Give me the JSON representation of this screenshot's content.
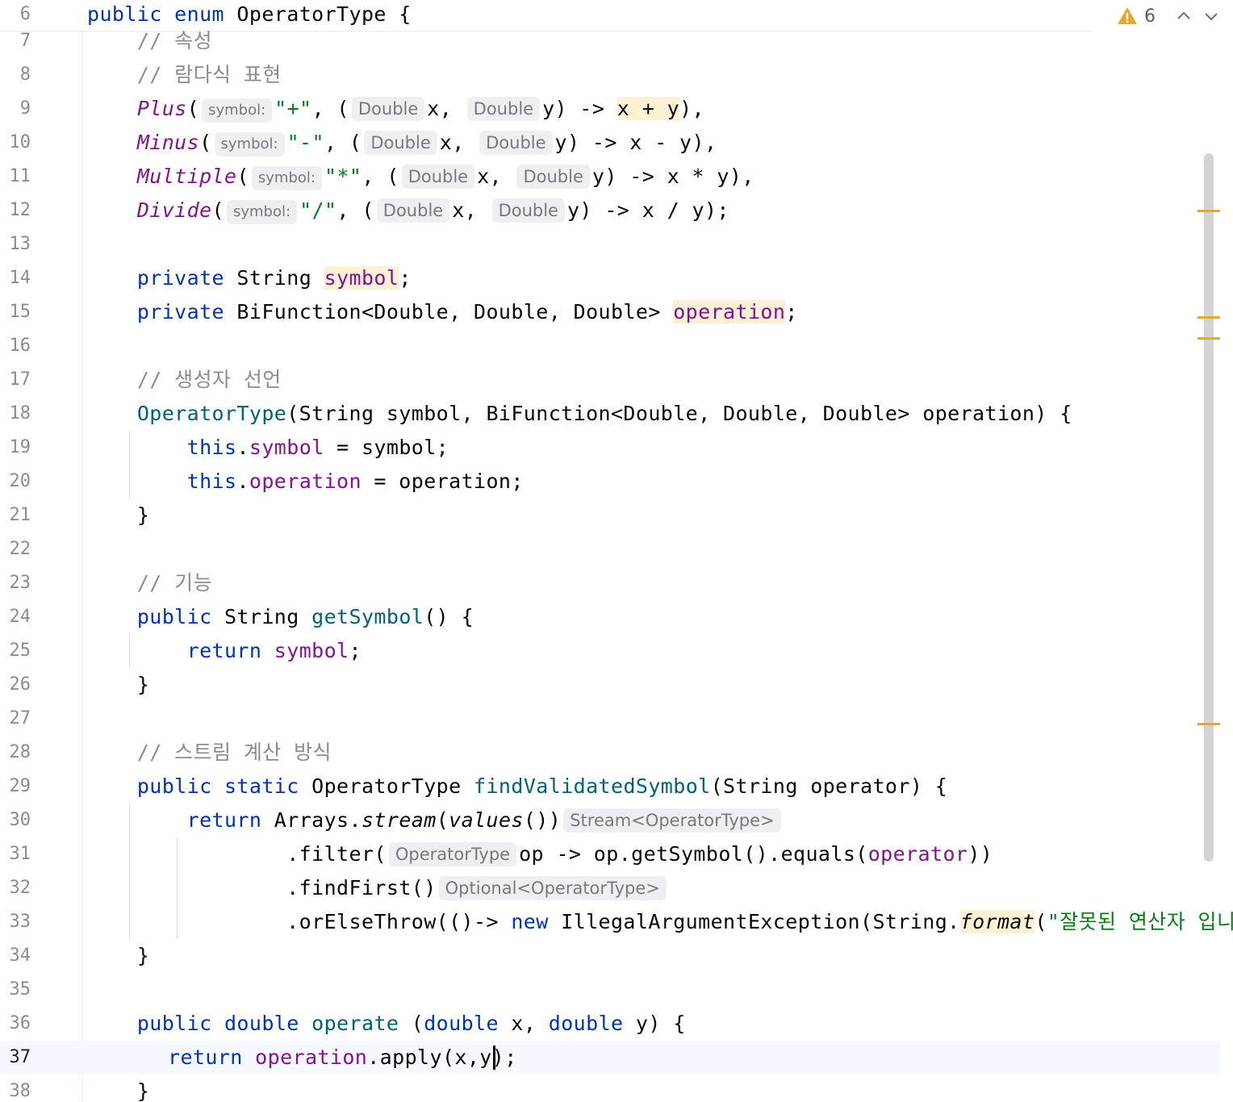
{
  "inspection": {
    "warning_count": "6",
    "warning_color": "#e5a82a"
  },
  "colors": {
    "keyword": "#0033b3",
    "field": "#871094",
    "string": "#067d17",
    "comment": "#8c8c8c",
    "method_decl": "#00627a",
    "highlight": "#fcf1d4",
    "hint_bg": "#eeeff2"
  },
  "lines": {
    "n6": "6",
    "n7": "7",
    "n8": "8",
    "n9": "9",
    "n10": "10",
    "n11": "11",
    "n12": "12",
    "n13": "13",
    "n14": "14",
    "n15": "15",
    "n16": "16",
    "n17": "17",
    "n18": "18",
    "n19": "19",
    "n20": "20",
    "n21": "21",
    "n22": "22",
    "n23": "23",
    "n24": "24",
    "n25": "25",
    "n26": "26",
    "n27": "27",
    "n28": "28",
    "n29": "29",
    "n30": "30",
    "n31": "31",
    "n32": "32",
    "n33": "33",
    "n34": "34",
    "n35": "35",
    "n36": "36",
    "n37": "37",
    "n38": "38"
  },
  "code": {
    "l6": {
      "kw1": "public",
      "kw2": "enum",
      "rest": " OperatorType {"
    },
    "l7": {
      "comment": "// 속성"
    },
    "l8": {
      "comment": "// 람다식 표현"
    },
    "l9": {
      "name": "Plus",
      "open": "(",
      "hint_symbol": "symbol:",
      "str": "\"+\"",
      "sep": ", (",
      "hint_x": "Double",
      "px": "x, ",
      "hint_y": "Double",
      "py": "y) -> ",
      "expr": "x + y",
      "close": "),"
    },
    "l10": {
      "name": "Minus",
      "open": "(",
      "hint_symbol": "symbol:",
      "str": "\"-\"",
      "sep": ", (",
      "hint_x": "Double",
      "px": "x, ",
      "hint_y": "Double",
      "py": "y) -> x - y),"
    },
    "l11": {
      "name": "Multiple",
      "open": "(",
      "hint_symbol": "symbol:",
      "str": "\"*\"",
      "sep": ", (",
      "hint_x": "Double",
      "px": "x, ",
      "hint_y": "Double",
      "py": "y) -> x * y),"
    },
    "l12": {
      "name": "Divide",
      "open": "(",
      "hint_symbol": "symbol:",
      "str": "\"/\"",
      "sep": ", (",
      "hint_x": "Double",
      "px": "x, ",
      "hint_y": "Double",
      "py": "y) -> x / y);"
    },
    "l14": {
      "kw": "private",
      "type": " String ",
      "field": "symbol",
      "end": ";"
    },
    "l15": {
      "kw": "private",
      "type": " BiFunction<Double, Double, Double> ",
      "field": "operation",
      "end": ";"
    },
    "l17": {
      "comment": "// 생성자 선언"
    },
    "l18": {
      "name": "OperatorType",
      "rest": "(String symbol, BiFunction<Double, Double, Double> operation) {"
    },
    "l19": {
      "kw": "this",
      "dot": ".",
      "field": "symbol",
      "rest": " = symbol;"
    },
    "l20": {
      "kw": "this",
      "dot": ".",
      "field": "operation",
      "rest": " = operation;"
    },
    "l21": {
      "brace": "}"
    },
    "l23": {
      "comment": "// 기능"
    },
    "l24": {
      "kw": "public",
      "type": " String ",
      "name": "getSymbol",
      "rest": "() {"
    },
    "l25": {
      "kw": "return",
      "field": "symbol",
      "end": ";"
    },
    "l26": {
      "brace": "}"
    },
    "l28": {
      "comment": "// 스트림 계산 방식"
    },
    "l29": {
      "kw1": "public",
      "kw2": "static",
      "type": " OperatorType ",
      "name": "findValidatedSymbol",
      "rest": "(String operator) {"
    },
    "l30": {
      "kw": "return",
      "p1": " Arrays.",
      "m1": "stream",
      "p2": "(",
      "m2": "values",
      "p3": "())",
      "hint": "Stream<OperatorType>"
    },
    "l31": {
      "p1": ".filter(",
      "hint": "OperatorType",
      "p2": "op -> op.getSymbol().equals(",
      "field": "operator",
      "p3": "))"
    },
    "l32": {
      "p1": ".findFirst()",
      "hint": "Optional<OperatorType>"
    },
    "l33": {
      "p1": ".orElseThrow(()-> ",
      "kw": "new",
      "p2": " IllegalArgumentException(String.",
      "m": "format",
      "p3": "(",
      "str": "\"잘못된 연산자 입니다.\"",
      "p4": ")))"
    },
    "l34": {
      "brace": "}"
    },
    "l36": {
      "kw1": "public",
      "kw2": "double",
      "name": "operate",
      "p1": " (",
      "kw3": "double",
      "p2": " x, ",
      "kw4": "double",
      "p3": " y) {"
    },
    "l37": {
      "kw": "return",
      "field": "operation",
      "rest": ".apply(x,y);"
    },
    "l38": {
      "brace": "}"
    }
  }
}
